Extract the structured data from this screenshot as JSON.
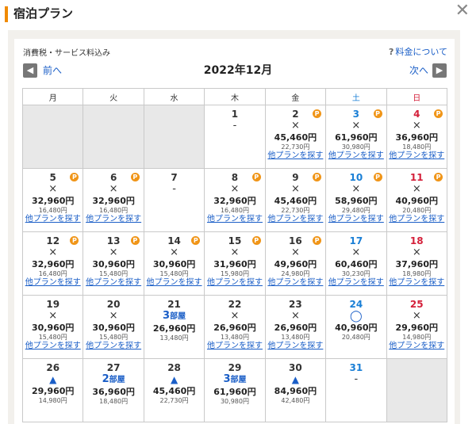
{
  "header": {
    "title": "宿泊プラン",
    "close_glyph": "✕"
  },
  "info": {
    "tax_note": "消費税・サービス料込み",
    "fee_link": "料金について",
    "fee_icon": "?"
  },
  "nav": {
    "prev_label": "前へ",
    "next_label": "次へ",
    "prev_icon": "◀",
    "next_icon": "▶",
    "month": "2022年12月"
  },
  "weekdays": [
    {
      "label": "月",
      "cls": ""
    },
    {
      "label": "火",
      "cls": ""
    },
    {
      "label": "水",
      "cls": ""
    },
    {
      "label": "木",
      "cls": ""
    },
    {
      "label": "金",
      "cls": ""
    },
    {
      "label": "土",
      "cls": "sat"
    },
    {
      "label": "日",
      "cls": "sun"
    }
  ],
  "other_label": "他プランを探す",
  "weeks": [
    [
      {
        "empty": true
      },
      {
        "empty": true
      },
      {
        "empty": true
      },
      {
        "day": "1",
        "avail": "-"
      },
      {
        "day": "2",
        "p": true,
        "avail": "×",
        "price": "45,460円",
        "pp": "22,730円",
        "other": true
      },
      {
        "day": "3",
        "dcls": "sat",
        "p": true,
        "avail": "×",
        "price": "61,960円",
        "pp": "30,980円",
        "other": true
      },
      {
        "day": "4",
        "dcls": "sun",
        "p": true,
        "avail": "×",
        "price": "36,960円",
        "pp": "18,480円",
        "other": true
      }
    ],
    [
      {
        "day": "5",
        "p": true,
        "avail": "×",
        "price": "32,960円",
        "pp": "16,480円",
        "other": true
      },
      {
        "day": "6",
        "p": true,
        "avail": "×",
        "price": "32,960円",
        "pp": "16,480円",
        "other": true
      },
      {
        "day": "7",
        "avail": "-"
      },
      {
        "day": "8",
        "p": true,
        "avail": "×",
        "price": "32,960円",
        "pp": "16,480円",
        "other": true
      },
      {
        "day": "9",
        "p": true,
        "avail": "×",
        "price": "45,460円",
        "pp": "22,730円",
        "other": true
      },
      {
        "day": "10",
        "dcls": "sat",
        "p": true,
        "avail": "×",
        "price": "58,960円",
        "pp": "29,480円",
        "other": true
      },
      {
        "day": "11",
        "dcls": "sun",
        "p": true,
        "avail": "×",
        "price": "40,960円",
        "pp": "20,480円",
        "other": true
      }
    ],
    [
      {
        "day": "12",
        "p": true,
        "avail": "×",
        "price": "32,960円",
        "pp": "16,480円",
        "other": true
      },
      {
        "day": "13",
        "p": true,
        "avail": "×",
        "price": "30,960円",
        "pp": "15,480円",
        "other": true
      },
      {
        "day": "14",
        "p": true,
        "avail": "×",
        "price": "30,960円",
        "pp": "15,480円",
        "other": true
      },
      {
        "day": "15",
        "p": true,
        "avail": "×",
        "price": "31,960円",
        "pp": "15,980円",
        "other": true
      },
      {
        "day": "16",
        "p": true,
        "avail": "×",
        "price": "49,960円",
        "pp": "24,980円",
        "other": true
      },
      {
        "day": "17",
        "dcls": "sat",
        "avail": "×",
        "price": "60,460円",
        "pp": "30,230円",
        "other": true
      },
      {
        "day": "18",
        "dcls": "sun",
        "avail": "×",
        "price": "37,960円",
        "pp": "18,980円",
        "other": true
      }
    ],
    [
      {
        "day": "19",
        "avail": "×",
        "price": "30,960円",
        "pp": "15,480円",
        "other": true
      },
      {
        "day": "20",
        "avail": "×",
        "price": "30,960円",
        "pp": "15,480円",
        "other": true
      },
      {
        "day": "21",
        "rooms": "3",
        "rooms_unit": "部屋",
        "price": "26,960円",
        "pp": "13,480円"
      },
      {
        "day": "22",
        "avail": "×",
        "price": "26,960円",
        "pp": "13,480円",
        "other": true
      },
      {
        "day": "23",
        "avail": "×",
        "price": "26,960円",
        "pp": "13,480円",
        "other": true
      },
      {
        "day": "24",
        "dcls": "sat",
        "avail": "◯",
        "acls": "circ",
        "price": "40,960円",
        "pp": "20,480円"
      },
      {
        "day": "25",
        "dcls": "sun",
        "avail": "×",
        "price": "29,960円",
        "pp": "14,980円",
        "other": true
      }
    ],
    [
      {
        "day": "26",
        "avail": "▲",
        "acls": "tri",
        "price": "29,960円",
        "pp": "14,980円"
      },
      {
        "day": "27",
        "rooms": "2",
        "rooms_unit": "部屋",
        "price": "36,960円",
        "pp": "18,480円"
      },
      {
        "day": "28",
        "avail": "▲",
        "acls": "tri",
        "price": "45,460円",
        "pp": "22,730円"
      },
      {
        "day": "29",
        "rooms": "3",
        "rooms_unit": "部屋",
        "price": "61,960円",
        "pp": "30,980円"
      },
      {
        "day": "30",
        "avail": "▲",
        "acls": "tri",
        "price": "84,960円",
        "pp": "42,480円"
      },
      {
        "day": "31",
        "dcls": "sat",
        "avail": "-"
      },
      {
        "empty": true
      }
    ]
  ]
}
